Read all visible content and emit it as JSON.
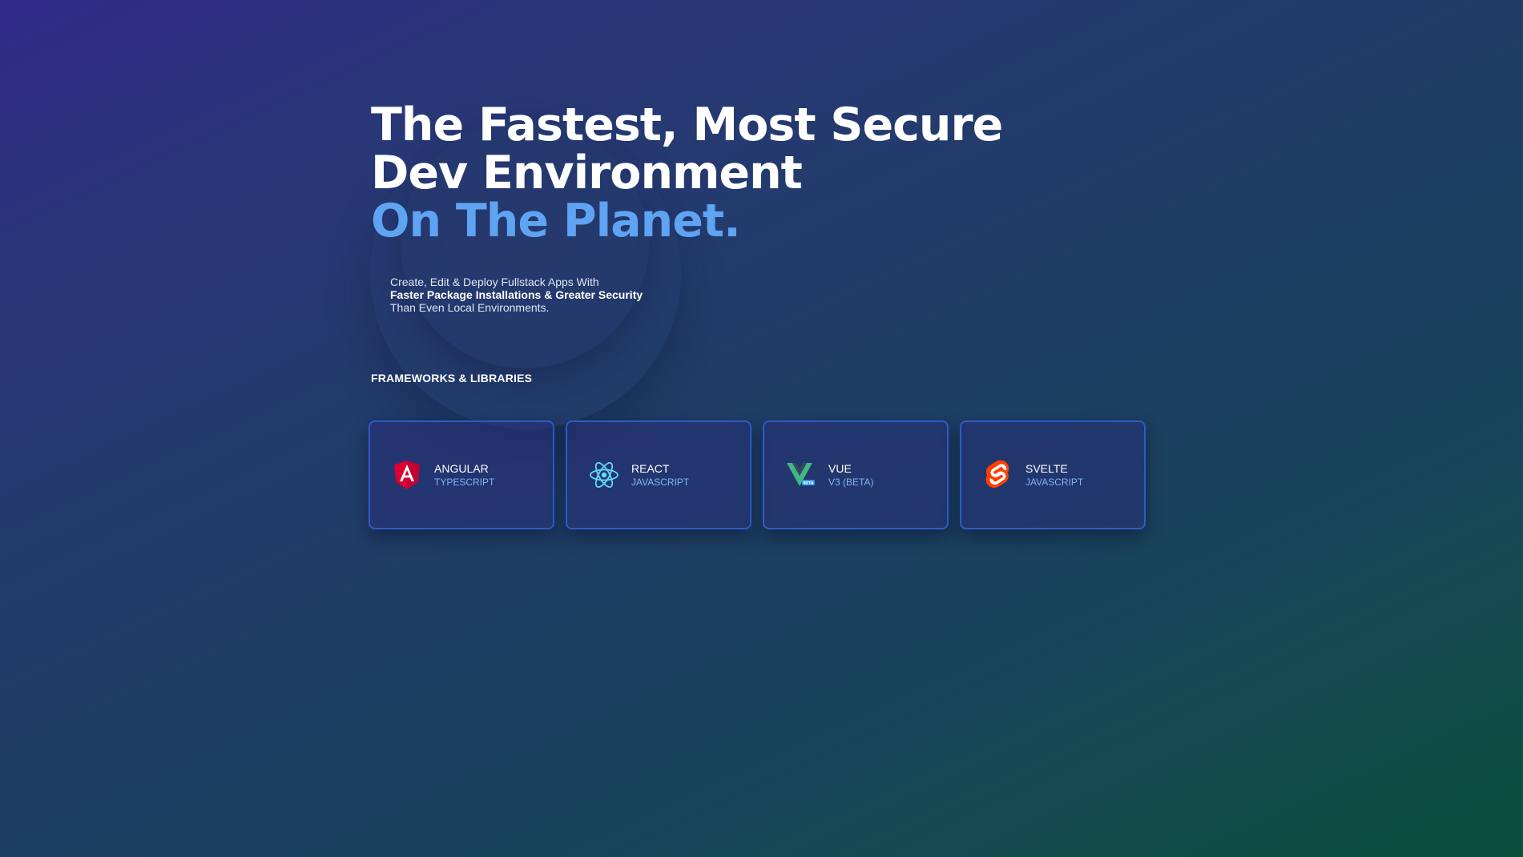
{
  "hero": {
    "line1": "The Fastest, Most Secure",
    "line2": "Dev Environment",
    "accent": "On The Planet.",
    "sub_line1": "Create, Edit & Deploy Fullstack Apps With",
    "sub_strong": "Faster Package Installations & Greater Security",
    "sub_line3": "Than Even Local Environments."
  },
  "section": {
    "label": "FRAMEWORKS & LIBRARIES"
  },
  "frameworks": [
    {
      "name": "ANGULAR",
      "sub": "TYPESCRIPT",
      "icon": "angular-icon"
    },
    {
      "name": "REACT",
      "sub": "JAVASCRIPT",
      "icon": "react-icon"
    },
    {
      "name": "VUE",
      "sub": "V3 (BETA)",
      "icon": "vue-icon",
      "badge": "BETA"
    },
    {
      "name": "SVELTE",
      "sub": "JAVASCRIPT",
      "icon": "svelte-icon"
    }
  ],
  "colors": {
    "accent": "#5fa3f3",
    "card_border": "#2f5bc9",
    "card_sub": "#7fb6f6",
    "angular": "#dd0031",
    "react": "#61dafb",
    "vue_green": "#41b883",
    "vue_dark": "#35495e",
    "svelte": "#ff3e00"
  }
}
